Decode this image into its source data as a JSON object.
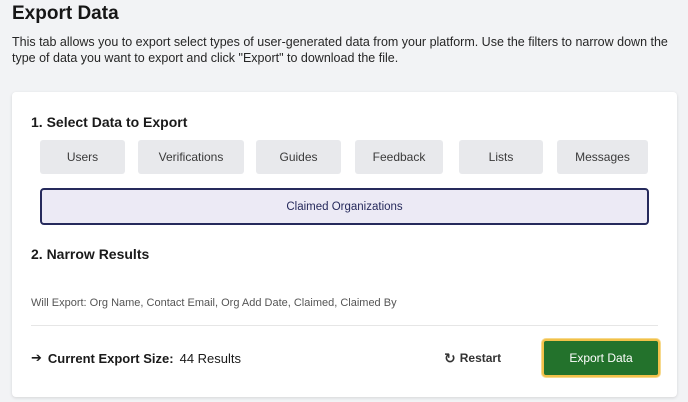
{
  "header": {
    "title": "Export Data",
    "description": "This tab allows you to export select types of user-generated data from your platform. Use the filters to narrow down the type of data you want to export and click \"Export\" to download the file."
  },
  "select_section": {
    "title": "1. Select Data to Export",
    "types": [
      "Users",
      "Verifications",
      "Guides",
      "Feedback",
      "Lists",
      "Messages"
    ],
    "selected": "Claimed Organizations"
  },
  "narrow_section": {
    "title": "2. Narrow Results",
    "will_export": "Will Export: Org Name, Contact Email, Org Add Date, Claimed, Claimed By"
  },
  "footer": {
    "size_label": "Current Export Size:",
    "size_value": "44 Results",
    "restart_label": "Restart",
    "export_label": "Export Data"
  },
  "icons": {
    "arrow": "arrow-right-icon",
    "restart": "restart-icon"
  },
  "colors": {
    "selected_border": "#262a5c",
    "export_button": "#23722c",
    "export_focus_ring": "#f2c14a"
  }
}
